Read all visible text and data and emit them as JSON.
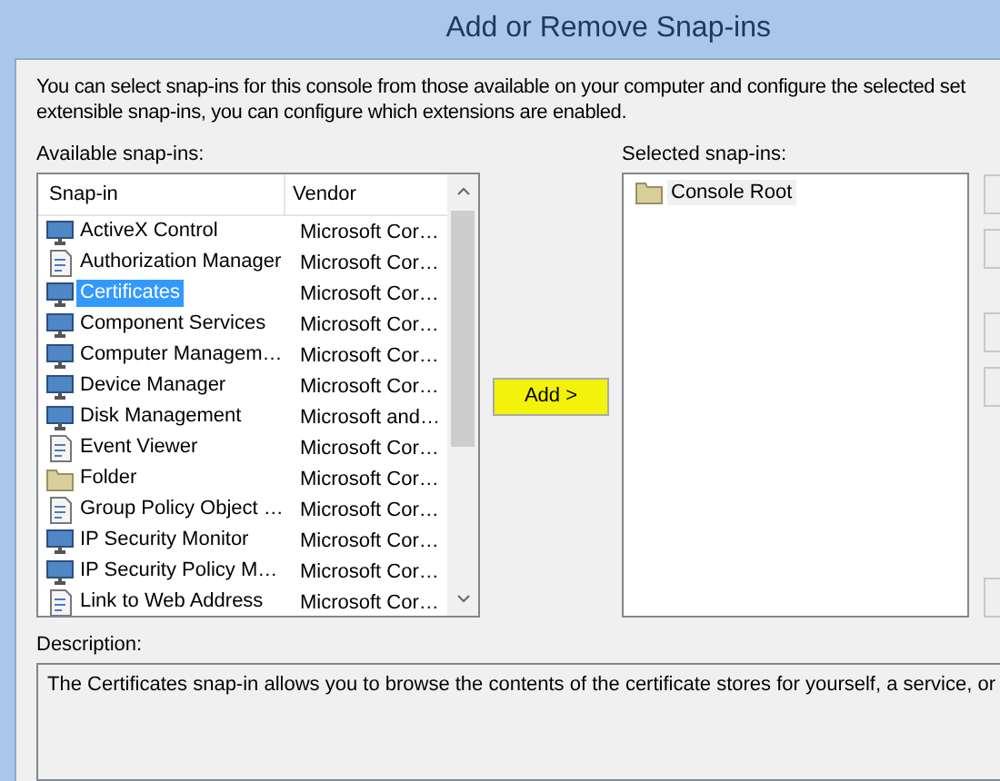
{
  "window": {
    "title": "Add or Remove Snap-ins"
  },
  "intro": [
    "You can select snap-ins for this console from those available on your computer and configure the selected set",
    "extensible snap-ins, you can configure which extensions are enabled."
  ],
  "available": {
    "label": "Available snap-ins:",
    "columns": [
      "Snap-in",
      "Vendor"
    ],
    "rows": [
      {
        "name": "ActiveX Control",
        "vendor": "Microsoft Cor…",
        "kind": "computer",
        "selected": false
      },
      {
        "name": "Authorization Manager",
        "vendor": "Microsoft Cor…",
        "kind": "document",
        "selected": false
      },
      {
        "name": "Certificates",
        "vendor": "Microsoft Cor…",
        "kind": "computer",
        "selected": true
      },
      {
        "name": "Component Services",
        "vendor": "Microsoft Cor…",
        "kind": "computer",
        "selected": false
      },
      {
        "name": "Computer Managem…",
        "vendor": "Microsoft Cor…",
        "kind": "computer",
        "selected": false
      },
      {
        "name": "Device Manager",
        "vendor": "Microsoft Cor…",
        "kind": "computer",
        "selected": false
      },
      {
        "name": "Disk Management",
        "vendor": "Microsoft and…",
        "kind": "computer",
        "selected": false
      },
      {
        "name": "Event Viewer",
        "vendor": "Microsoft Cor…",
        "kind": "document",
        "selected": false
      },
      {
        "name": "Folder",
        "vendor": "Microsoft Cor…",
        "kind": "folder",
        "selected": false
      },
      {
        "name": "Group Policy Object …",
        "vendor": "Microsoft Cor…",
        "kind": "document",
        "selected": false
      },
      {
        "name": "IP Security Monitor",
        "vendor": "Microsoft Cor…",
        "kind": "computer",
        "selected": false
      },
      {
        "name": "IP Security Policy M…",
        "vendor": "Microsoft Cor…",
        "kind": "computer",
        "selected": false
      },
      {
        "name": "Link to Web Address",
        "vendor": "Microsoft Cor…",
        "kind": "document",
        "selected": false
      }
    ]
  },
  "add_button": "Add >",
  "selected_snapins": {
    "label": "Selected snap-ins:",
    "items": [
      {
        "name": "Console Root",
        "kind": "folder"
      }
    ]
  },
  "description": {
    "label": "Description:",
    "text": "The Certificates snap-in allows you to browse the contents of the certificate stores for yourself, a service, or"
  }
}
